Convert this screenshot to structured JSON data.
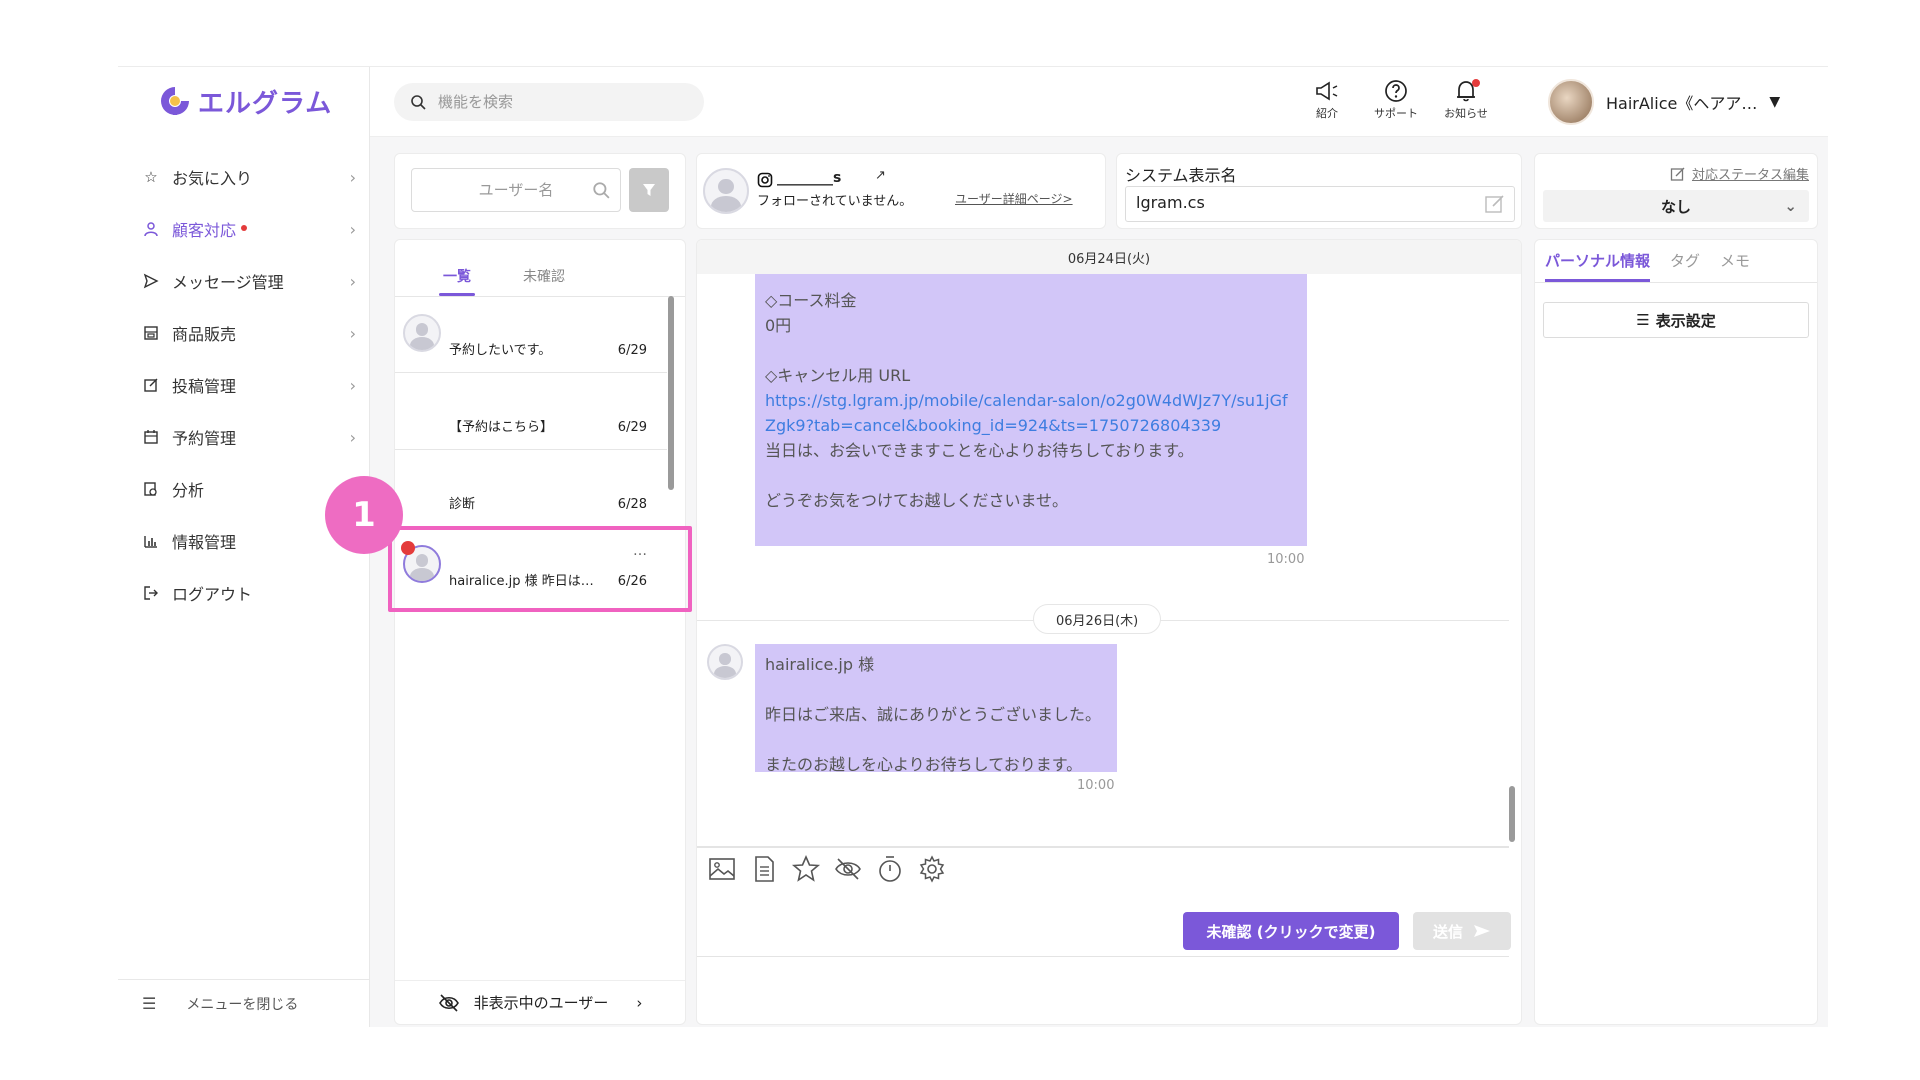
{
  "brand": {
    "name": "エルグラム",
    "accent": "#7b58d9"
  },
  "sidebar": {
    "items": [
      {
        "label": "お気に入り",
        "icon": "star-icon"
      },
      {
        "label": "顧客対応",
        "icon": "user-icon",
        "active": true,
        "dot": true
      },
      {
        "label": "メッセージ管理",
        "icon": "send-icon"
      },
      {
        "label": "商品販売",
        "icon": "shop-icon"
      },
      {
        "label": "投稿管理",
        "icon": "edit-icon"
      },
      {
        "label": "予約管理",
        "icon": "calendar-icon"
      },
      {
        "label": "分析",
        "icon": "report-icon"
      },
      {
        "label": "情報管理",
        "icon": "chart-icon"
      },
      {
        "label": "ログアウト",
        "icon": "logout-icon"
      }
    ],
    "close_menu": "メニューを閉じる"
  },
  "header": {
    "search_placeholder": "機能を検索",
    "tools": [
      {
        "label": "紹介",
        "icon": "megaphone-icon"
      },
      {
        "label": "サポート",
        "icon": "help-icon"
      },
      {
        "label": "お知らせ",
        "icon": "bell-icon"
      }
    ],
    "account_name": "HairAlice《ヘアア…"
  },
  "user_list": {
    "search_placeholder": "ユーザー名",
    "tabs": [
      "一覧",
      "未確認"
    ],
    "conversations": [
      {
        "preview": "予約したいです。",
        "date": "6/29",
        "has_avatar": true
      },
      {
        "preview": "【予約はこちら】",
        "date": "6/29",
        "has_avatar": false
      },
      {
        "preview": "診断",
        "date": "6/28",
        "has_avatar": false
      },
      {
        "preview": "hairalice.jp 様 昨日は…",
        "date": "6/26",
        "has_avatar": true,
        "unread": true,
        "selected": true
      }
    ],
    "more": "…",
    "step_number": "1",
    "hidden_users": "非表示中のユーザー"
  },
  "user_card": {
    "handle": "________s",
    "follow_status": "フォローされていません。",
    "detail_link": "ユーザー詳細ページ>"
  },
  "system_name": {
    "label": "システム表示名",
    "value": "lgram.cs"
  },
  "status": {
    "edit_link": "対応ステータス編集",
    "value": "なし"
  },
  "chat": {
    "dates": [
      "06月24日(火)",
      "06月26日(木)"
    ],
    "msg1_a": "◇コース料金\n0円\n\n◇キャンセル用 URL",
    "msg1_link": "https://stg.lgram.jp/mobile/calendar-salon/o2g0W4dWJz7Y/su1jGfZgk9?tab=cancel&booking_id=924&ts=1750726804339",
    "msg1_b": "\n当日は、お会いできますことを心よりお待ちしております。\n\nどうぞお気をつけてお越しくださいませ。",
    "msg1_time": "10:00",
    "msg2": "hairalice.jp 様\n\n昨日はご来店、誠にありがとうございました。\n\nまたのお越しを心よりお待ちしております。",
    "msg2_time": "10:00"
  },
  "composer": {
    "icons": [
      "image-icon",
      "document-icon",
      "star-icon",
      "hide-icon",
      "timer-icon",
      "settings-icon"
    ],
    "status_button": "未確認 (クリックで変更)",
    "send_button": "送信"
  },
  "right_panel": {
    "tabs": [
      "パーソナル情報",
      "タグ",
      "メモ"
    ],
    "display_settings": "表示設定"
  }
}
